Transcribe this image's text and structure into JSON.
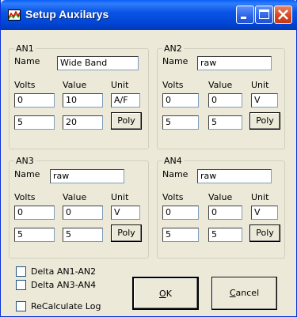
{
  "window": {
    "title": "Setup Auxilarys"
  },
  "labels": {
    "name": "Name",
    "volts": "Volts",
    "value": "Value",
    "unit": "Unit"
  },
  "groups": [
    {
      "title": "AN1",
      "name": "Wide Band",
      "volts": [
        "0",
        "5"
      ],
      "values": [
        "10",
        "20"
      ],
      "unit": "A/F",
      "poly": "Poly"
    },
    {
      "title": "AN2",
      "name": "raw",
      "volts": [
        "0",
        "5"
      ],
      "values": [
        "0",
        "5"
      ],
      "unit": "V",
      "poly": "Poly"
    },
    {
      "title": "AN3",
      "name": "raw",
      "volts": [
        "0",
        "5"
      ],
      "values": [
        "0",
        "5"
      ],
      "unit": "V",
      "poly": "Poly"
    },
    {
      "title": "AN4",
      "name": "raw",
      "volts": [
        "0",
        "5"
      ],
      "values": [
        "0",
        "5"
      ],
      "unit": "V",
      "poly": "Poly"
    }
  ],
  "checkboxes": [
    {
      "label": "Delta AN1-AN2",
      "checked": false
    },
    {
      "label": "Delta AN3-AN4",
      "checked": false
    },
    {
      "label": "ReCalculate Log",
      "checked": false
    }
  ],
  "buttons": {
    "ok_accel": "O",
    "ok_rest": "K",
    "cancel_accel": "C",
    "cancel_rest": "ancel"
  }
}
